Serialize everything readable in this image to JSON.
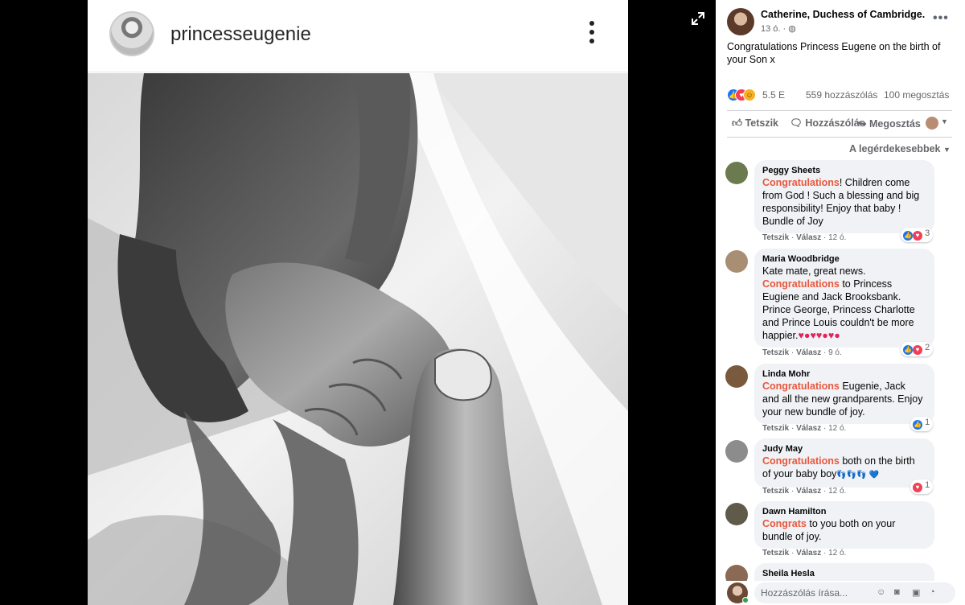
{
  "instagram": {
    "username": "princesseugenie"
  },
  "post": {
    "author": "Catherine, Duchess of Cambridge.",
    "time": "13 ó. ·",
    "text": "Congratulations Princess Eugene on the birth of your Son x",
    "reaction_count": "5.5 E",
    "comment_count": "559 hozzászólás",
    "share_count": "100 megosztás"
  },
  "actions": {
    "like": "Tetszik",
    "comment": "Hozzászólás",
    "share": "Megosztás"
  },
  "sort_label": "A legérdekesebbek",
  "comments": [
    {
      "name": "Peggy Sheets",
      "highlight": "Congratulations",
      "text": "! Children come from God ! Such a blessing and big responsibility! Enjoy that baby ! Bundle of Joy",
      "like": "Tetszik",
      "reply": "Válasz",
      "time": "12 ó.",
      "reaction_count": "3",
      "avatar_color": "#6b7a4f"
    },
    {
      "name": "Maria Woodbridge",
      "pre": "Kate mate, great news.",
      "highlight": "Congratulations",
      "text": " to Princess Eugiene and Jack Brooksbank. Prince George, Princess Charlotte and Prince Louis couldn't be more happier.",
      "emoji": "♥●♥♥●♥●",
      "like": "Tetszik",
      "reply": "Válasz",
      "time": "9 ó.",
      "reaction_count": "2",
      "avatar_color": "#a88f73"
    },
    {
      "name": "Linda Mohr",
      "highlight": "Congratulations",
      "text": " Eugenie, Jack and all the new grandparents. Enjoy your new bundle of joy.",
      "like": "Tetszik",
      "reply": "Válasz",
      "time": "12 ó.",
      "reaction_count": "1",
      "avatar_color": "#7a5a3c"
    },
    {
      "name": "Judy May",
      "highlight": "Congratulations",
      "text": " both on the birth of your baby boy",
      "emoji": "👣👣👣 💙",
      "like": "Tetszik",
      "reply": "Válasz",
      "time": "12 ó.",
      "reaction_count": "1",
      "avatar_color": "#8c8c8c"
    },
    {
      "name": "Dawn Hamilton",
      "highlight": "Congrats",
      "text": " to you both on your bundle of joy.",
      "like": "Tetszik",
      "reply": "Válasz",
      "time": "12 ó.",
      "avatar_color": "#5f5a4a"
    },
    {
      "name": "Sheila Hesla",
      "avatar_color": "#8a6a55"
    }
  ],
  "composer": {
    "placeholder": "Hozzászólás írása..."
  },
  "colors": {
    "highlight": "#e9573d",
    "facebook_blue": "#1877f2"
  }
}
